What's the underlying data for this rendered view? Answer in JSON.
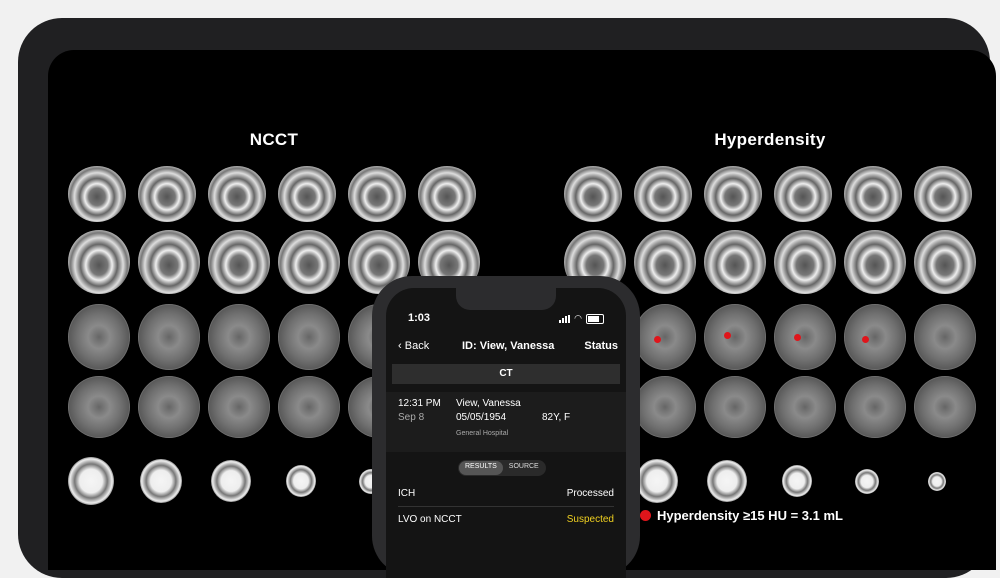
{
  "panels": {
    "left_title": "NCCT",
    "right_title": "Hyperdensity"
  },
  "legend": {
    "text": "Hyperdensity  ≥15 HU = 3.1 mL",
    "color": "#e0151b"
  },
  "phone": {
    "status_time": "1:03",
    "nav": {
      "back": "Back",
      "title": "ID: View, Vanessa",
      "status": "Status"
    },
    "section": "CT",
    "study": {
      "time": "12:31 PM",
      "date": "Sep 8",
      "name": "View, Vanessa",
      "dob": "05/05/1954",
      "age_sex": "82Y, F",
      "hospital": "General Hospital"
    },
    "tabs": [
      "RESULTS",
      "SOURCE"
    ],
    "results": [
      {
        "label": "ICH",
        "value": "Processed"
      },
      {
        "label": "LVO on NCCT",
        "value": "Suspected"
      }
    ]
  }
}
